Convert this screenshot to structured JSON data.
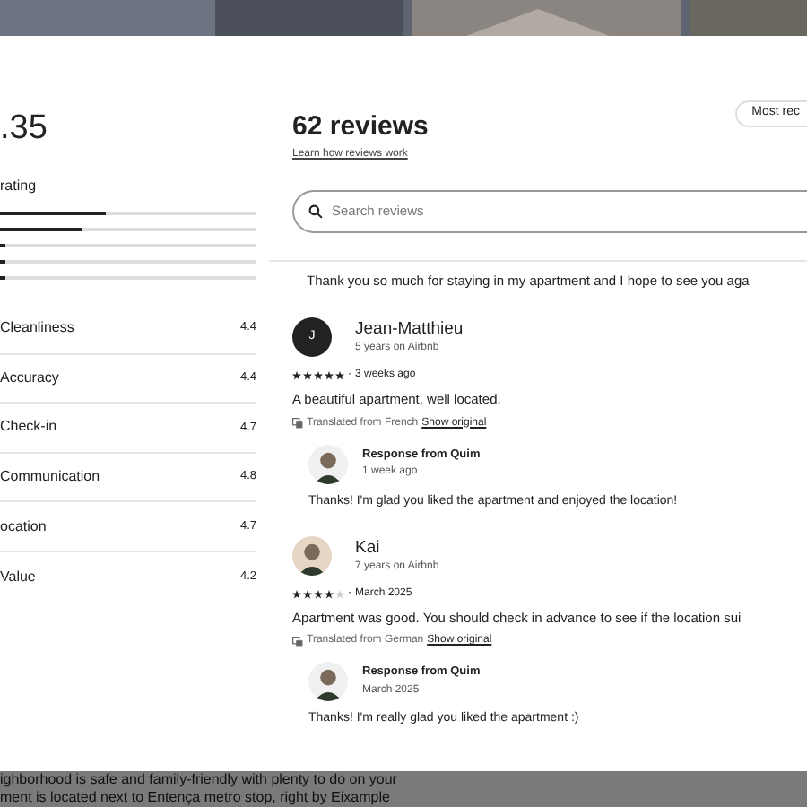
{
  "rating_summary": {
    "score": ".35",
    "label": "rating",
    "bars": [
      {
        "level": 0.41
      },
      {
        "level": 0.32
      },
      {
        "level": 0.02
      },
      {
        "level": 0.02
      },
      {
        "level": 0.02
      }
    ],
    "categories": [
      {
        "name": "Cleanliness",
        "value": "4.4"
      },
      {
        "name": "Accuracy",
        "value": "4.4"
      },
      {
        "name": "Check-in",
        "value": "4.7"
      },
      {
        "name": "Communication",
        "value": "4.8"
      },
      {
        "name": "ocation",
        "value": "4.7"
      },
      {
        "name": "Value",
        "value": "4.2"
      }
    ]
  },
  "reviews_header": {
    "title": "62 reviews",
    "link": "Learn how reviews work",
    "sort": "Most rec"
  },
  "search": {
    "placeholder": "Search reviews"
  },
  "previous_text": "Thank you so much for staying in my apartment and I hope to see you aga",
  "reviews": [
    {
      "avatar": {
        "kind": "initial",
        "initial": "J"
      },
      "name": "Jean-Matthieu",
      "tenure": "5 years on Airbnb",
      "stars": 5,
      "separator": "·",
      "date": "3 weeks ago",
      "text": "A beautiful apartment, well located.",
      "translated": "Translated from French",
      "show_original": "Show original",
      "response": {
        "title": "Response from Quim",
        "date": "1 week ago",
        "text": "Thanks! I'm glad you liked the apartment and enjoyed the location!"
      }
    },
    {
      "name": "Kai",
      "tenure": "7 years on Airbnb",
      "stars": 4,
      "separator": "·",
      "date": "March 2025",
      "text": "Apartment was good. You should check in advance to see if the location sui",
      "translated": "Translated from German",
      "show_original": "Show original",
      "response": {
        "title": "Response from Quim",
        "date": "March 2025",
        "text": "Thanks! I'm really glad you liked the apartment :)"
      }
    }
  ],
  "background_text": [
    "ighborhood is safe and family-friendly with plenty to do on your",
    "ment is located next to Entença metro stop, right by Eixample"
  ]
}
